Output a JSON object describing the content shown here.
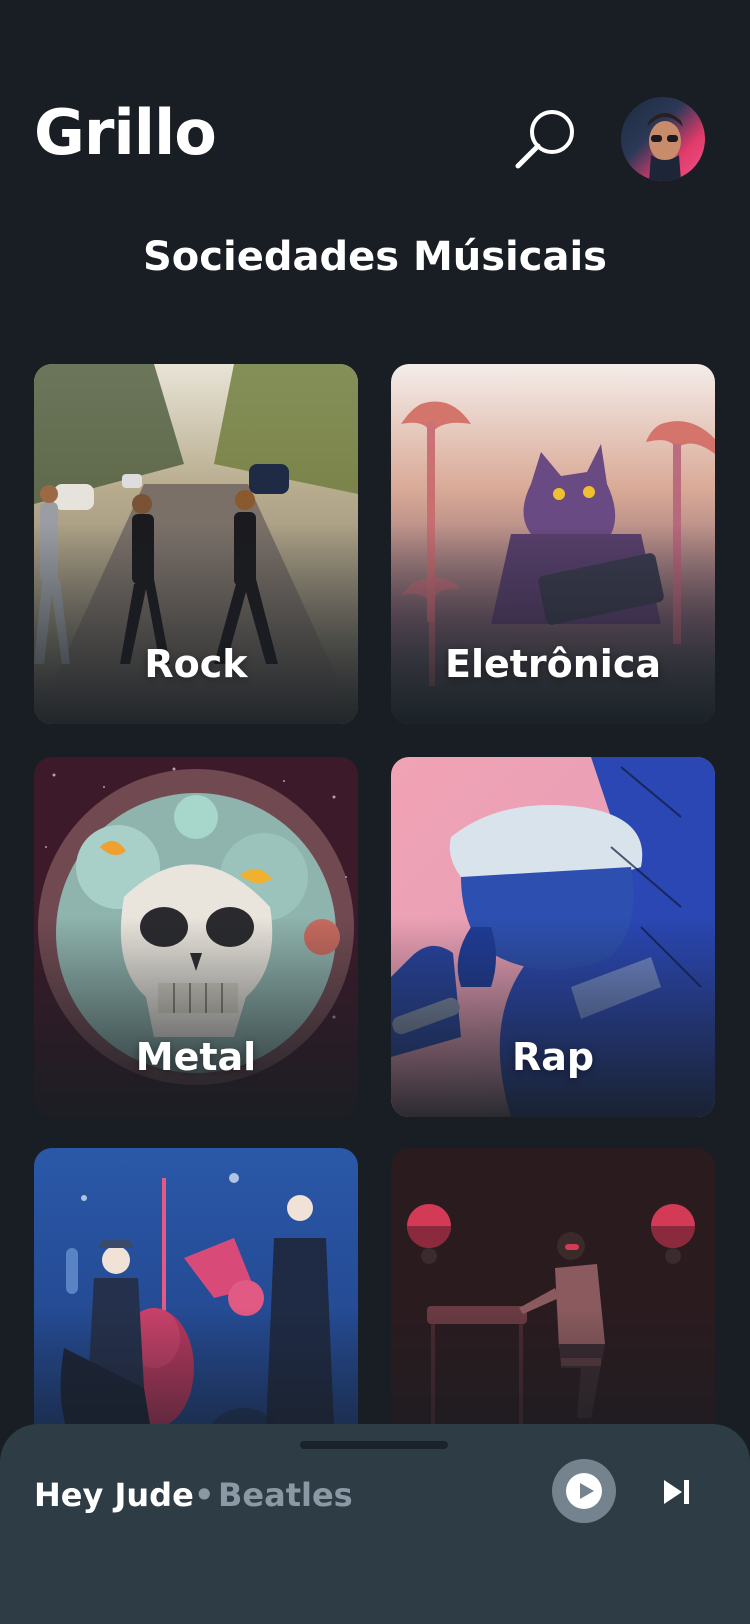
{
  "header": {
    "app_title": "Grillo",
    "search_icon": "search-icon",
    "avatar": "user-avatar"
  },
  "section": {
    "title": "Sociedades Músicais"
  },
  "genres": [
    {
      "label": "Rock"
    },
    {
      "label": "Eletrônica"
    },
    {
      "label": "Metal"
    },
    {
      "label": "Rap"
    },
    {
      "label": ""
    },
    {
      "label": ""
    }
  ],
  "player": {
    "track": "Hey Jude",
    "separator": "•",
    "artist": "Beatles",
    "play_icon": "play-icon",
    "next_icon": "skip-next-icon"
  },
  "colors": {
    "background": "#181e23",
    "player_bg": "#2e3c45",
    "muted_text": "#8a99a3"
  }
}
